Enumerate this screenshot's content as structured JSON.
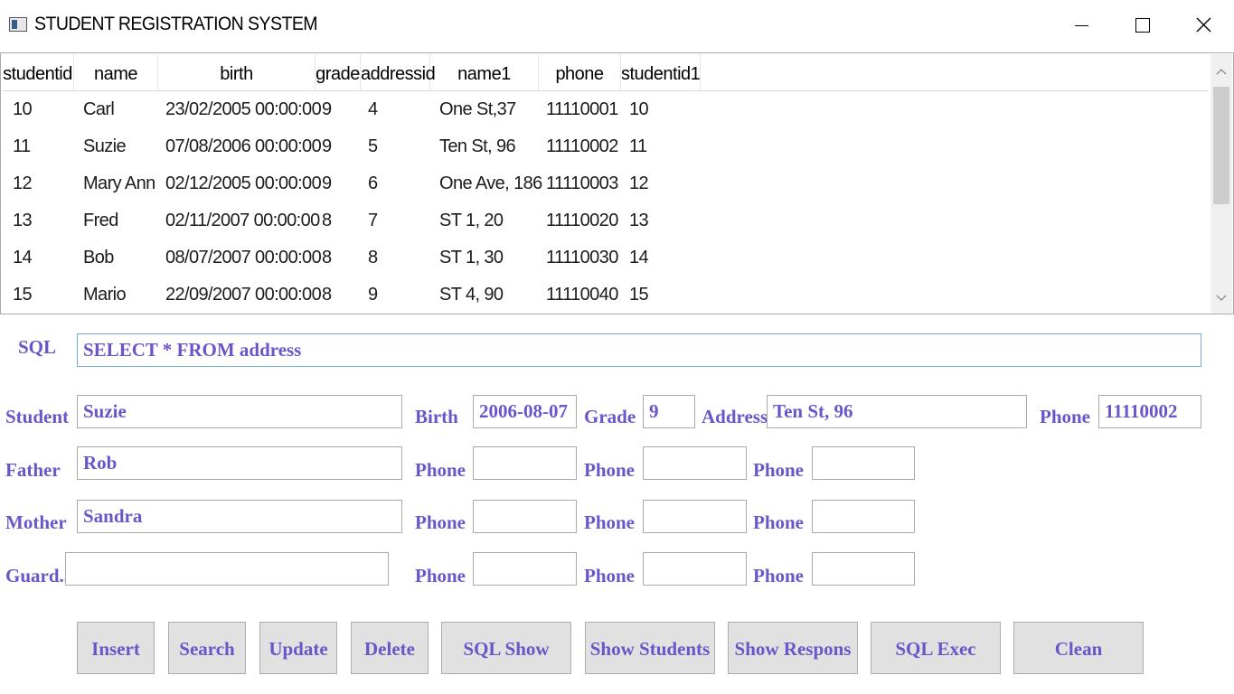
{
  "window": {
    "title": "STUDENT REGISTRATION SYSTEM",
    "controls": {
      "minimize": "minimize-icon",
      "maximize": "maximize-icon",
      "close": "close-icon"
    }
  },
  "grid": {
    "columns": [
      "studentid",
      "name",
      "birth",
      "grade",
      "addressid",
      "name1",
      "phone",
      "studentid1"
    ],
    "rows": [
      [
        "10",
        "Carl",
        "23/02/2005 00:00:00",
        "9",
        "4",
        "One St,37",
        "11110001",
        "10"
      ],
      [
        "11",
        "Suzie",
        "07/08/2006 00:00:00",
        "9",
        "5",
        "Ten St, 96",
        "11110002",
        "11"
      ],
      [
        "12",
        "Mary Ann",
        "02/12/2005 00:00:00",
        "9",
        "6",
        "One Ave, 186",
        "11110003",
        "12"
      ],
      [
        "13",
        "Fred",
        "02/11/2007 00:00:00",
        "8",
        "7",
        "ST 1, 20",
        "11110020",
        "13"
      ],
      [
        "14",
        "Bob",
        "08/07/2007 00:00:00",
        "8",
        "8",
        "ST 1, 30",
        "11110030",
        "14"
      ],
      [
        "15",
        "Mario",
        "22/09/2007 00:00:00",
        "8",
        "9",
        "ST 4, 90",
        "11110040",
        "15"
      ]
    ]
  },
  "form": {
    "sql_label": "SQL",
    "sql_value": "SELECT * FROM address",
    "student_label": "Student",
    "student_value": "Suzie",
    "birth_label": "Birth",
    "birth_value": "2006-08-07",
    "grade_label": "Grade",
    "grade_value": "9",
    "address_label": "Address",
    "address_value": "Ten St, 96",
    "phone_label": "Phone",
    "phone_value": "11110002",
    "father_label": "Father",
    "father_value": "Rob",
    "mother_label": "Mother",
    "mother_value": "Sandra",
    "guardian_label": "Guard..",
    "guardian_value": ""
  },
  "buttons": {
    "insert": "Insert",
    "search": "Search",
    "update": "Update",
    "delete": "Delete",
    "sql_show": "SQL Show",
    "show_students": "Show Students",
    "show_respons": "Show Respons",
    "sql_exec": "SQL Exec",
    "clean": "Clean"
  },
  "colors": {
    "label": "#6a55c9",
    "button_bg": "#e1e1e1",
    "focus_border": "#7aa7d8"
  }
}
